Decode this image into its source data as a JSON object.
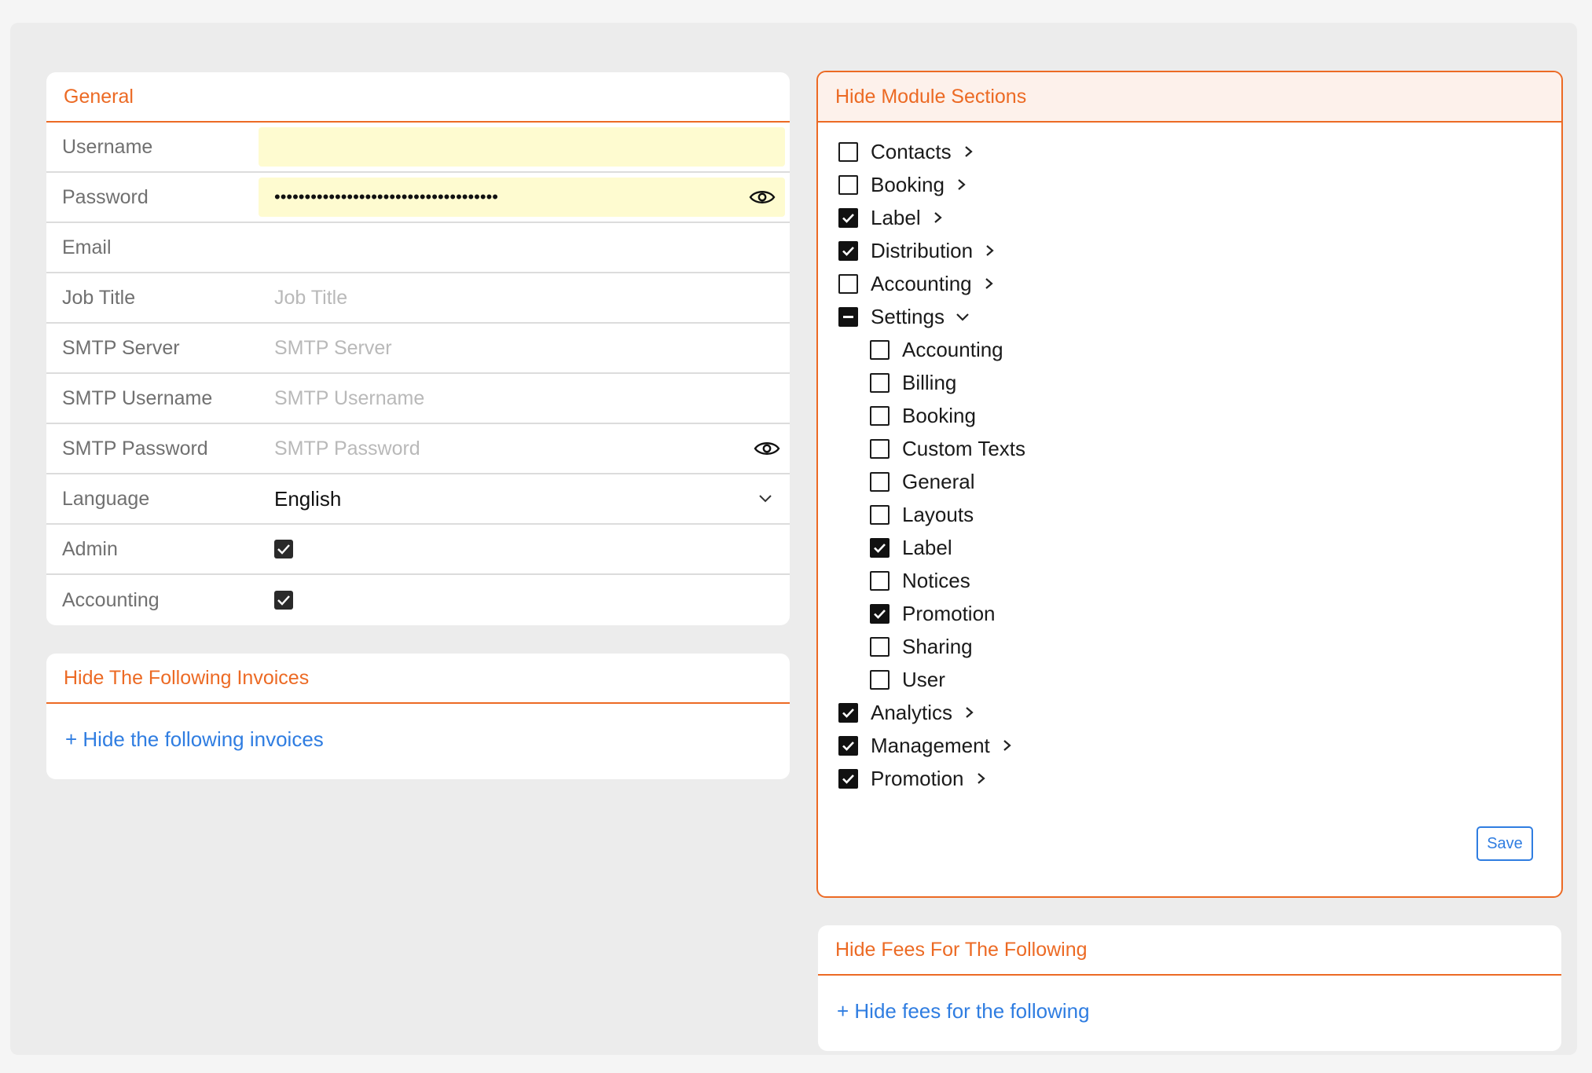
{
  "general": {
    "title": "General",
    "username": {
      "label": "Username",
      "value": ""
    },
    "password": {
      "label": "Password",
      "value": "•••••••••••••••••••••••••••••••••••••"
    },
    "email": {
      "label": "Email",
      "value": ""
    },
    "job_title": {
      "label": "Job Title",
      "placeholder": "Job Title"
    },
    "smtp_server": {
      "label": "SMTP Server",
      "placeholder": "SMTP Server"
    },
    "smtp_username": {
      "label": "SMTP Username",
      "placeholder": "SMTP Username"
    },
    "smtp_password": {
      "label": "SMTP Password",
      "placeholder": "SMTP Password"
    },
    "language": {
      "label": "Language",
      "value": "English"
    },
    "admin": {
      "label": "Admin",
      "checked": true
    },
    "accounting": {
      "label": "Accounting",
      "checked": true
    }
  },
  "invoices": {
    "title": "Hide The Following Invoices",
    "add_link": "+ Hide the following invoices"
  },
  "modules": {
    "title": "Hide Module Sections",
    "items": [
      {
        "label": "Contacts",
        "state": "unchecked",
        "expand": "collapsed"
      },
      {
        "label": "Booking",
        "state": "unchecked",
        "expand": "collapsed"
      },
      {
        "label": "Label",
        "state": "checked",
        "expand": "collapsed"
      },
      {
        "label": "Distribution",
        "state": "checked",
        "expand": "collapsed"
      },
      {
        "label": "Accounting",
        "state": "unchecked",
        "expand": "collapsed"
      },
      {
        "label": "Settings",
        "state": "indeterminate",
        "expand": "expanded",
        "children": [
          {
            "label": "Accounting",
            "state": "unchecked"
          },
          {
            "label": "Billing",
            "state": "unchecked"
          },
          {
            "label": "Booking",
            "state": "unchecked"
          },
          {
            "label": "Custom Texts",
            "state": "unchecked"
          },
          {
            "label": "General",
            "state": "unchecked"
          },
          {
            "label": "Layouts",
            "state": "unchecked"
          },
          {
            "label": "Label",
            "state": "checked"
          },
          {
            "label": "Notices",
            "state": "unchecked"
          },
          {
            "label": "Promotion",
            "state": "checked"
          },
          {
            "label": "Sharing",
            "state": "unchecked"
          },
          {
            "label": "User",
            "state": "unchecked"
          }
        ]
      },
      {
        "label": "Analytics",
        "state": "checked",
        "expand": "collapsed"
      },
      {
        "label": "Management",
        "state": "checked",
        "expand": "collapsed"
      },
      {
        "label": "Promotion",
        "state": "checked",
        "expand": "collapsed"
      }
    ],
    "save_label": "Save"
  },
  "fees": {
    "title": "Hide Fees For The Following",
    "add_link": "+ Hide fees for the following"
  },
  "colors": {
    "accent": "#ec6a24",
    "link": "#2f7de1",
    "autofill": "#fefbd0",
    "background": "#ececec"
  },
  "icons": {
    "eye": "eye-icon",
    "chevron_right": "chevron-right-icon",
    "chevron_down": "chevron-down-icon",
    "checkmark": "checkmark-icon"
  }
}
